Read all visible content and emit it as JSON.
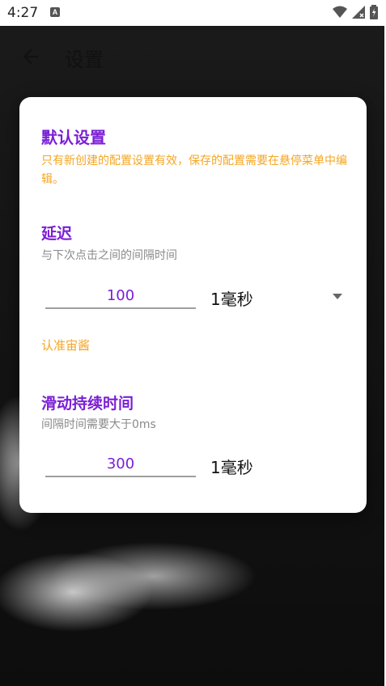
{
  "status_bar": {
    "time": "4:27",
    "notification_icon": "A"
  },
  "toolbar": {
    "title": "设置"
  },
  "dialog": {
    "title": "默认设置",
    "description": "只有新创建的配置设置有效，保存的配置需要在悬停菜单中编辑。",
    "delay": {
      "label": "延迟",
      "hint": "与下次点击之间的间隔时间",
      "value": "100",
      "unit": "1毫秒"
    },
    "link_text": "认准宙酱",
    "swipe": {
      "label": "滑动持续时间",
      "hint": "间隔时间需要大于0ms",
      "value": "300",
      "unit": "1毫秒"
    }
  },
  "colors": {
    "accent": "#7b1fd6",
    "warning": "#f5a623"
  }
}
